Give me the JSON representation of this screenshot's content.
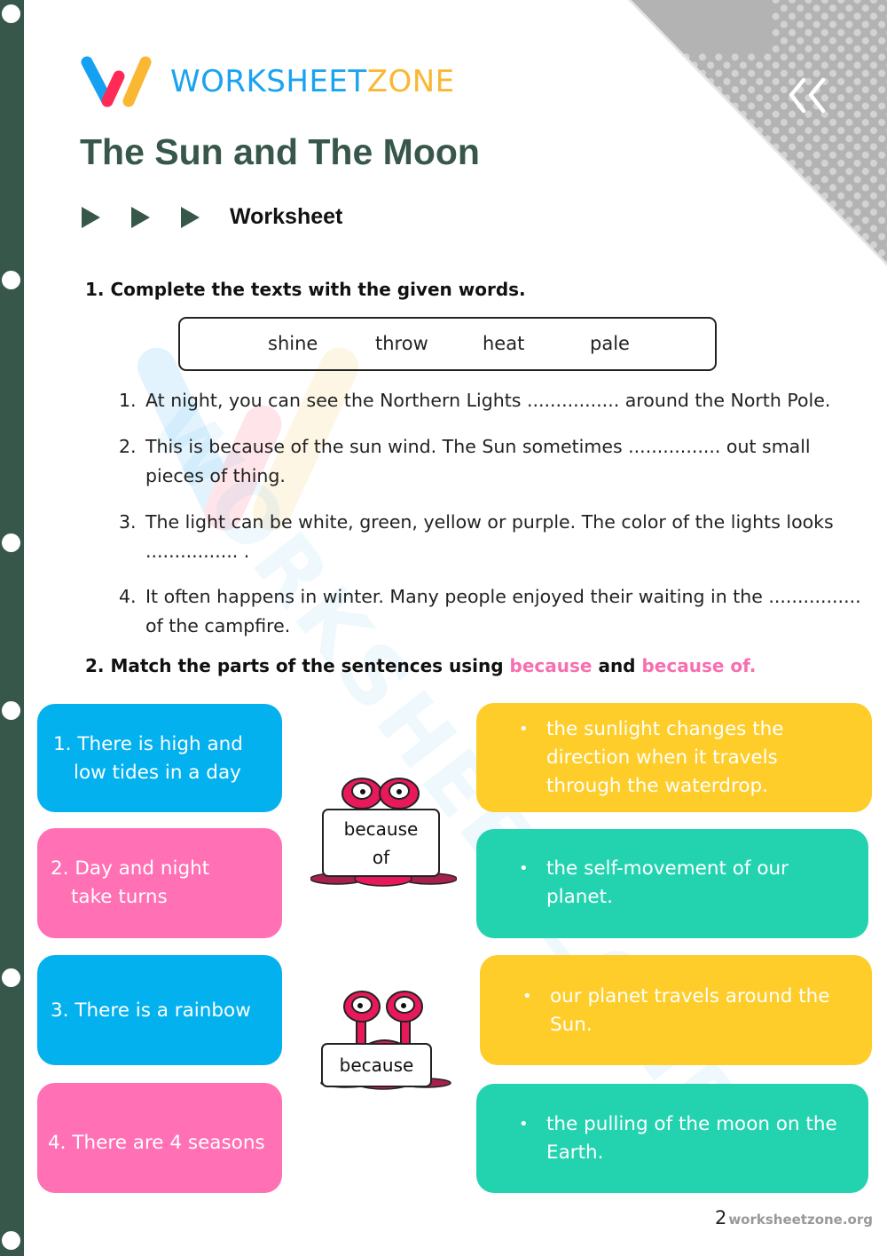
{
  "brand": {
    "name_part1": "WORKSHEET",
    "name_part2": "ZONE",
    "colors": {
      "blue": "#1aa3f0",
      "red": "#ff2a55",
      "yellow": "#f9b833",
      "dark_green": "#37574a"
    }
  },
  "header": {
    "title": "The Sun and The Moon",
    "subtitle": "Worksheet",
    "corner_icon": "double-chevron-left-icon"
  },
  "section1": {
    "heading": "1. Complete the texts with the given words.",
    "word_bank": [
      "shine",
      "throw",
      "heat",
      "pale"
    ],
    "items": [
      {
        "num": "1.",
        "text": "At night, you can see the Northern Lights ................ around the North Pole."
      },
      {
        "num": "2.",
        "text": "This is because of the sun wind. The Sun sometimes ................ out small pieces of thing."
      },
      {
        "num": "3.",
        "text": "The light can be white, green, yellow or purple. The color of the lights looks ................ ."
      },
      {
        "num": "4.",
        "text": "It often happens in winter. Many people enjoyed their waiting in the ................ of the campfire."
      }
    ]
  },
  "section2": {
    "heading_prefix": "2. Match the parts of the sentences using ",
    "keyword1": "because",
    "heading_mid": " and ",
    "keyword2": "because of.",
    "left_cards": [
      {
        "text": "1. There is high and\n    low tides in a day",
        "line1": "1. There is high and",
        "line2": "low tides in a day",
        "color": "#03b1ef"
      },
      {
        "text": "2. Day and night take turns",
        "line1": "2. Day and night",
        "line2": "take turns",
        "color": "#ff70b4"
      },
      {
        "text": "3. There is a rainbow",
        "line1": "3. There is a rainbow",
        "line2": "",
        "color": "#03b1ef"
      },
      {
        "text": "4. There are 4 seasons",
        "line1": "4. There are 4 seasons",
        "line2": "",
        "color": "#ff70b4"
      }
    ],
    "right_cards": [
      {
        "bullet": "•",
        "text": "the sunlight changes the direction when it travels through the waterdrop.",
        "color": "#fecd2a"
      },
      {
        "bullet": "•",
        "text": "the self-movement of our planet.",
        "color": "#23d3b0"
      },
      {
        "bullet": "•",
        "text": "our planet travels around the Sun.",
        "color": "#fecd2a"
      },
      {
        "bullet": "•",
        "text": "the pulling of the moon on the Earth.",
        "color": "#23d3b0"
      }
    ],
    "signs": [
      {
        "line1": "because",
        "line2": "of"
      },
      {
        "line1": "because",
        "line2": ""
      }
    ]
  },
  "watermark": "WORKSHEETZONE",
  "footer": {
    "page_number": "2",
    "site": "worksheetzone.org"
  }
}
